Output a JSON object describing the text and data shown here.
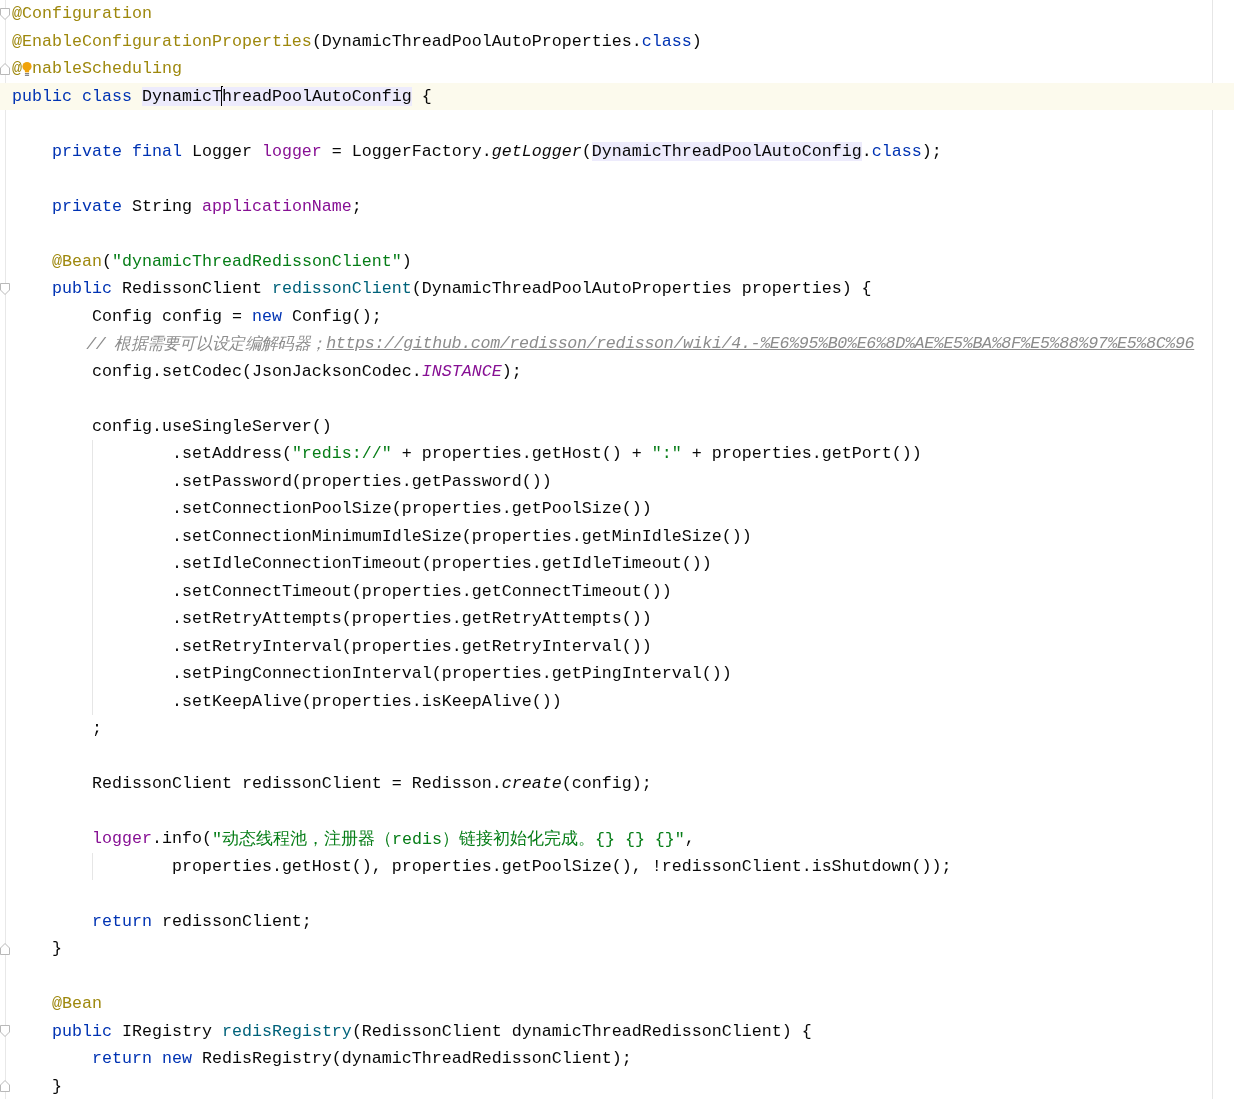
{
  "editor": {
    "lines": [
      {
        "fold": {
          "kind": "start"
        },
        "tokens": [
          {
            "t": "@Configuration",
            "kind": "ann"
          }
        ]
      },
      {
        "tokens": [
          {
            "t": "@EnableConfigurationProperties",
            "kind": "ann"
          },
          {
            "t": "(DynamicThreadPoolAutoProperties.",
            "kind": "p"
          },
          {
            "t": "class",
            "kind": "kw"
          },
          {
            "t": ")",
            "kind": "p"
          }
        ]
      },
      {
        "fold": {
          "kind": "end"
        },
        "tokens": [
          {
            "t": "@",
            "kind": "ann"
          },
          {
            "kind": "bulb"
          },
          {
            "t": "nableScheduling",
            "kind": "ann"
          }
        ]
      },
      {
        "current": true,
        "tokens": [
          {
            "t": "public class ",
            "kind": "kw"
          },
          {
            "t": "DynamicT",
            "kind": "p",
            "hl": true,
            "caret": true
          },
          {
            "t": "hreadPoolAutoConfig",
            "kind": "p",
            "hl": true
          },
          {
            "t": " {",
            "kind": "p"
          }
        ]
      },
      {
        "blank_above": true,
        "tokens": [
          {
            "t": "    private final ",
            "kind": "kw"
          },
          {
            "t": "Logger ",
            "kind": "p"
          },
          {
            "t": "logger",
            "kind": "fld"
          },
          {
            "t": " = LoggerFactory.",
            "kind": "p"
          },
          {
            "t": "getLogger",
            "kind": "it"
          },
          {
            "t": "(",
            "kind": "p"
          },
          {
            "t": "DynamicThreadPoolAutoConfig",
            "kind": "p",
            "hl": true
          },
          {
            "t": ".",
            "kind": "p"
          },
          {
            "t": "class",
            "kind": "kw"
          },
          {
            "t": ");",
            "kind": "p"
          }
        ]
      },
      {
        "blank_above": true,
        "tokens": [
          {
            "t": "    private ",
            "kind": "kw"
          },
          {
            "t": "String ",
            "kind": "p"
          },
          {
            "t": "applicationName",
            "kind": "fld"
          },
          {
            "t": ";",
            "kind": "p"
          }
        ]
      },
      {
        "blank_above": true,
        "tokens": [
          {
            "t": "    @Bean",
            "kind": "ann"
          },
          {
            "t": "(",
            "kind": "p"
          },
          {
            "t": "\"dynamicThreadRedissonClient\"",
            "kind": "str"
          },
          {
            "t": ")",
            "kind": "p"
          }
        ]
      },
      {
        "fold": {
          "kind": "start"
        },
        "tokens": [
          {
            "t": "    public ",
            "kind": "kw"
          },
          {
            "t": "RedissonClient ",
            "kind": "p"
          },
          {
            "t": "redissonClient",
            "kind": "fn"
          },
          {
            "t": "(DynamicThreadPoolAutoProperties properties) {",
            "kind": "p"
          }
        ]
      },
      {
        "tokens": [
          {
            "t": "        Config config = ",
            "kind": "p"
          },
          {
            "t": "new",
            "kind": "kw"
          },
          {
            "t": " Config();",
            "kind": "p"
          }
        ]
      },
      {
        "tokens": [
          {
            "t": "        // 根据需要可以设定编解码器；",
            "kind": "cm"
          },
          {
            "t": "https://github.com/redisson/redisson/wiki/4.-%E6%95%B0%E6%8D%AE%E5%BA%8F%E5%88%97%E5%8C%96",
            "kind": "link"
          }
        ]
      },
      {
        "tokens": [
          {
            "t": "        config.setCodec(JsonJacksonCodec.",
            "kind": "p"
          },
          {
            "t": "INSTANCE",
            "kind": "sf"
          },
          {
            "t": ");",
            "kind": "p"
          }
        ]
      },
      {
        "blank_above": true,
        "tokens": [
          {
            "t": "        config.useSingleServer()",
            "kind": "p"
          }
        ]
      },
      {
        "tokens": [
          {
            "t": "                .setAddress(",
            "kind": "p"
          },
          {
            "t": "\"redis://\"",
            "kind": "str"
          },
          {
            "t": " + properties.getHost() + ",
            "kind": "p"
          },
          {
            "t": "\":\"",
            "kind": "str"
          },
          {
            "t": " + properties.getPort())",
            "kind": "p"
          }
        ]
      },
      {
        "tokens": [
          {
            "t": "                .setPassword(properties.getPassword())",
            "kind": "p"
          }
        ]
      },
      {
        "tokens": [
          {
            "t": "                .setConnectionPoolSize(properties.getPoolSize())",
            "kind": "p"
          }
        ]
      },
      {
        "tokens": [
          {
            "t": "                .setConnectionMinimumIdleSize(properties.getMinIdleSize())",
            "kind": "p"
          }
        ]
      },
      {
        "tokens": [
          {
            "t": "                .setIdleConnectionTimeout(properties.getIdleTimeout())",
            "kind": "p"
          }
        ]
      },
      {
        "tokens": [
          {
            "t": "                .setConnectTimeout(properties.getConnectTimeout())",
            "kind": "p"
          }
        ]
      },
      {
        "tokens": [
          {
            "t": "                .setRetryAttempts(properties.getRetryAttempts())",
            "kind": "p"
          }
        ]
      },
      {
        "tokens": [
          {
            "t": "                .setRetryInterval(properties.getRetryInterval())",
            "kind": "p"
          }
        ]
      },
      {
        "tokens": [
          {
            "t": "                .setPingConnectionInterval(properties.getPingInterval())",
            "kind": "p"
          }
        ]
      },
      {
        "tokens": [
          {
            "t": "                .setKeepAlive(properties.isKeepAlive())",
            "kind": "p"
          }
        ]
      },
      {
        "tokens": [
          {
            "t": "        ;",
            "kind": "p"
          }
        ]
      },
      {
        "blank_above": true,
        "tokens": [
          {
            "t": "        RedissonClient redissonClient = Redisson.",
            "kind": "p"
          },
          {
            "t": "create",
            "kind": "it"
          },
          {
            "t": "(config);",
            "kind": "p"
          }
        ]
      },
      {
        "blank_above": true,
        "tokens": [
          {
            "t": "        logger",
            "kind": "fld"
          },
          {
            "t": ".info(",
            "kind": "p"
          },
          {
            "t": "\"动态线程池，注册器（redis）链接初始化完成。{} {} {}\"",
            "kind": "str"
          },
          {
            "t": ",",
            "kind": "p"
          }
        ]
      },
      {
        "tokens": [
          {
            "t": "                properties.getHost(), properties.getPoolSize(), !redissonClient.isShutdown());",
            "kind": "p"
          }
        ]
      },
      {
        "blank_above": true,
        "tokens": [
          {
            "t": "        return",
            "kind": "kw"
          },
          {
            "t": " redissonClient;",
            "kind": "p"
          }
        ]
      },
      {
        "fold": {
          "kind": "end"
        },
        "tokens": [
          {
            "t": "    }",
            "kind": "p"
          }
        ]
      },
      {
        "blank_above": true,
        "tokens": [
          {
            "t": "    @Bean",
            "kind": "ann"
          }
        ]
      },
      {
        "fold": {
          "kind": "start"
        },
        "tokens": [
          {
            "t": "    public ",
            "kind": "kw"
          },
          {
            "t": "IRegistry ",
            "kind": "p"
          },
          {
            "t": "redisRegistry",
            "kind": "fn"
          },
          {
            "t": "(RedissonClient dynamicThreadRedissonClient) {",
            "kind": "p"
          }
        ]
      },
      {
        "tokens": [
          {
            "t": "        return new ",
            "kind": "kw"
          },
          {
            "t": "RedisRegistry(dynamicThreadRedissonClient);",
            "kind": "p"
          }
        ]
      },
      {
        "fold": {
          "kind": "end"
        },
        "tokens": [
          {
            "t": "    }",
            "kind": "p"
          }
        ]
      }
    ]
  }
}
